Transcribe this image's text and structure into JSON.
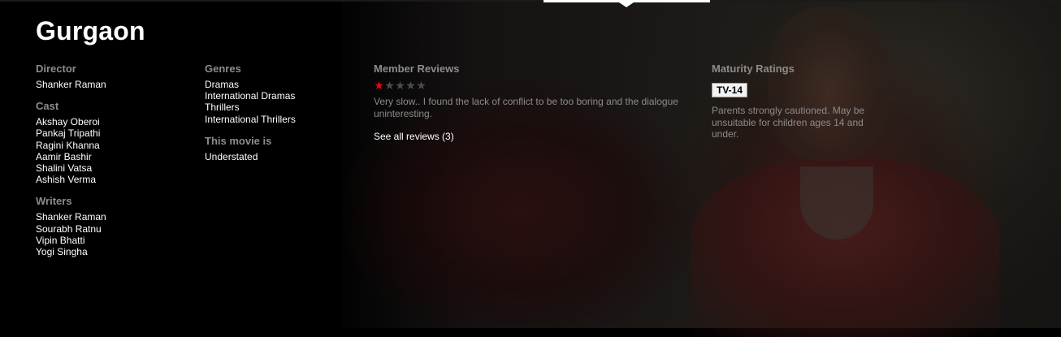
{
  "title": "Gurgaon",
  "director": {
    "label": "Director",
    "names": [
      "Shanker Raman"
    ]
  },
  "cast": {
    "label": "Cast",
    "names": [
      "Akshay Oberoi",
      "Pankaj Tripathi",
      "Ragini Khanna",
      "Aamir Bashir",
      "Shalini Vatsa",
      "Ashish Verma"
    ]
  },
  "writers": {
    "label": "Writers",
    "names": [
      "Shanker Raman",
      "Sourabh Ratnu",
      "Vipin Bhatti",
      "Yogi Singha"
    ]
  },
  "genres": {
    "label": "Genres",
    "items": [
      "Dramas",
      "International Dramas",
      "Thrillers",
      "International Thrillers"
    ]
  },
  "this_movie_is": {
    "label": "This movie is",
    "items": [
      "Understated"
    ]
  },
  "reviews": {
    "label": "Member Reviews",
    "rating": 1,
    "max_rating": 5,
    "star_filled_color": "#e50914",
    "star_empty_color": "#4d4d4d",
    "text": "Very slow.. I found the lack of conflict to be too boring and the dialogue uninteresting.",
    "see_all": "See all reviews (3)"
  },
  "maturity": {
    "label": "Maturity Ratings",
    "badge": "TV-14",
    "description": "Parents strongly cautioned. May be unsuitable for children ages 14 and under."
  }
}
